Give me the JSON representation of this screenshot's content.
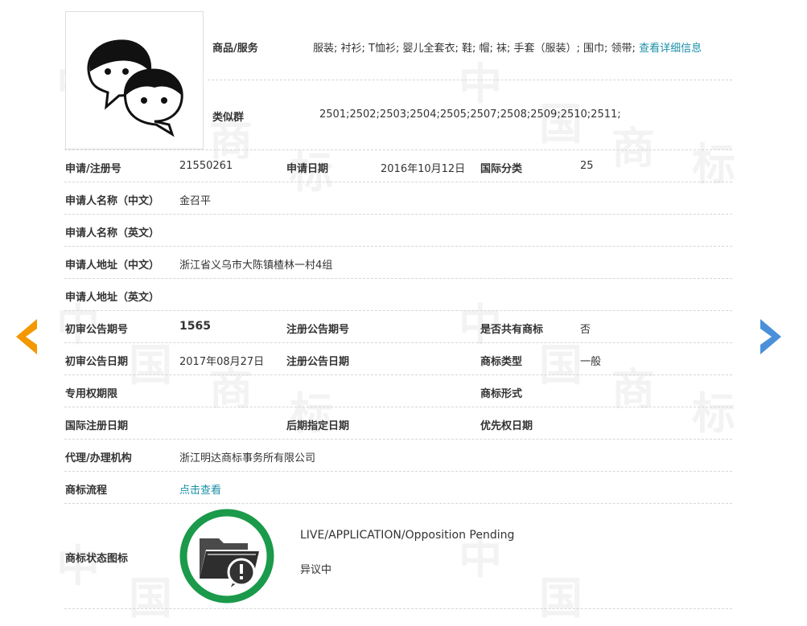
{
  "logo": {
    "icon": "two-faces-chat-icon"
  },
  "goods": {
    "label": "商品/服务",
    "value": "服装; 衬衫; T恤衫; 婴儿全套衣; 鞋; 帽; 袜; 手套（服装）; 围巾; 领带;",
    "link": "查看详细信息"
  },
  "similar_group": {
    "label": "类似群",
    "value": "2501;2502;2503;2504;2505;2507;2508;2509;2510;2511;"
  },
  "rows": {
    "reg_no": {
      "label": "申请/注册号",
      "value": "21550261"
    },
    "apply_date": {
      "label": "申请日期",
      "value": "2016年10月12日"
    },
    "intl_class": {
      "label": "国际分类",
      "value": "25"
    },
    "applicant_cn": {
      "label": "申请人名称（中文）",
      "value": "金召平"
    },
    "applicant_en": {
      "label": "申请人名称（英文）",
      "value": ""
    },
    "address_cn": {
      "label": "申请人地址（中文）",
      "value": "浙江省义乌市大陈镇楂林一村4组"
    },
    "address_en": {
      "label": "申请人地址（英文）",
      "value": ""
    },
    "prelim_issue": {
      "label": "初审公告期号",
      "value": "1565"
    },
    "reg_issue": {
      "label": "注册公告期号",
      "value": ""
    },
    "shared": {
      "label": "是否共有商标",
      "value": "否"
    },
    "prelim_date": {
      "label": "初审公告日期",
      "value": "2017年08月27日"
    },
    "reg_date": {
      "label": "注册公告日期",
      "value": ""
    },
    "tm_type": {
      "label": "商标类型",
      "value": "一般"
    },
    "exclusive_period": {
      "label": "专用权期限",
      "value": ""
    },
    "tm_form": {
      "label": "商标形式",
      "value": ""
    },
    "intl_reg_date": {
      "label": "国际注册日期",
      "value": ""
    },
    "later_date": {
      "label": "后期指定日期",
      "value": ""
    },
    "priority_date": {
      "label": "优先权日期",
      "value": ""
    },
    "agent": {
      "label": "代理/办理机构",
      "value": "浙江明达商标事务所有限公司"
    },
    "flow": {
      "label": "商标流程",
      "link": "点击查看"
    }
  },
  "status": {
    "label": "商标状态图标",
    "icon": "folder-alert-icon",
    "status_en": "LIVE/APPLICATION/Opposition Pending",
    "status_cn": "异议中",
    "ring_color": "#1a9a4a"
  },
  "nav": {
    "prev_color": "#f39800",
    "next_color": "#4a90d9"
  }
}
